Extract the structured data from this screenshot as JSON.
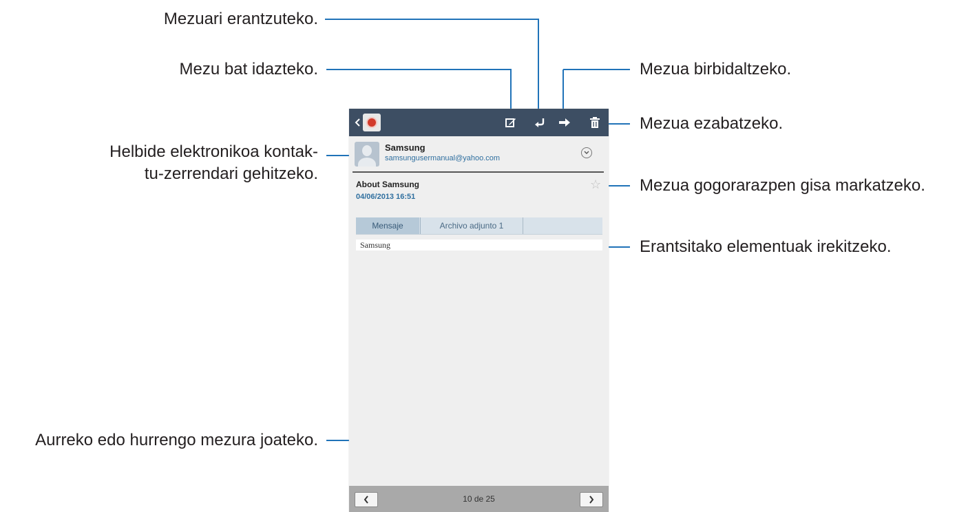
{
  "callouts": {
    "reply": "Mezuari erantzuteko.",
    "compose": "Mezu bat idazteko.",
    "forward": "Mezua birbidaltzeko.",
    "delete": "Mezua ezabatzeko.",
    "contact_line1": "Helbide elektronikoa kontak-",
    "contact_line2": "tu-zerrendari gehitzeko.",
    "reminder": "Mezua gogorarazpen gisa markatzeko.",
    "attachments": "Erantsitako elementuak irekitzeko.",
    "navigate": "Aurreko edo hurrengo mezura joateko."
  },
  "actionbar": {
    "back_icon": "chevron-left",
    "icons": [
      "compose-icon",
      "reply-icon",
      "forward-icon",
      "delete-icon"
    ]
  },
  "email": {
    "sender_name": "Samsung",
    "sender_email": "samsungusermanual@yahoo.com",
    "subject": "About Samsung",
    "date": "04/06/2013  16:51",
    "body": "Samsung"
  },
  "tabs": {
    "message": "Mensaje",
    "attachment": "Archivo adjunto 1"
  },
  "footer": {
    "page_count": "10 de 25"
  },
  "colors": {
    "actionbar": "#3d4e63",
    "leader_line": "#1f72b8",
    "accent_text": "#2f6f9f"
  }
}
